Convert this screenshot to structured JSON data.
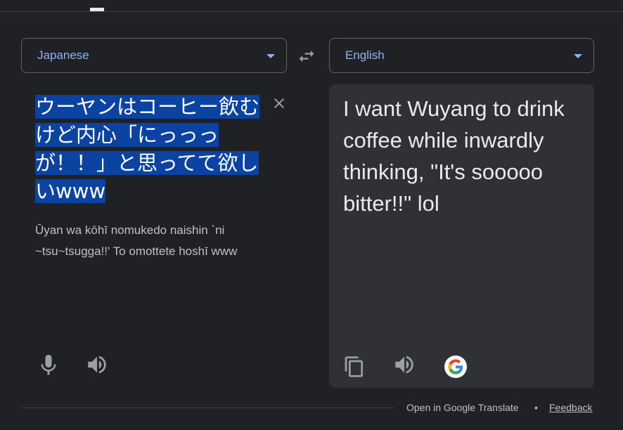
{
  "source_language": {
    "label": "Japanese"
  },
  "target_language": {
    "label": "English"
  },
  "source": {
    "text": "ウーヤンはコーヒー飲むけど内心「にっっっが！！」と思ってて欲しいwww",
    "romanization": "Ūyan wa kōhī nomukedo naishin `ni ~tsu~tsugga!!' To omottete hoshī www"
  },
  "translation": {
    "text": "I want Wuyang to drink coffee while inwardly thinking, \"It's sooooo bitter!!\" lol"
  },
  "icons": {
    "swap": "swap-arrows-icon",
    "clear": "close-icon",
    "mic": "microphone-icon",
    "listen": "speaker-icon",
    "copy": "copy-icon",
    "brand": "google-g-icon"
  },
  "footer": {
    "open_label": "Open in Google Translate",
    "separator": "•",
    "feedback_label": "Feedback"
  },
  "colors": {
    "background": "#202124",
    "accent": "#8ab4f8",
    "selection": "#0b43a3",
    "panel": "#303134"
  }
}
